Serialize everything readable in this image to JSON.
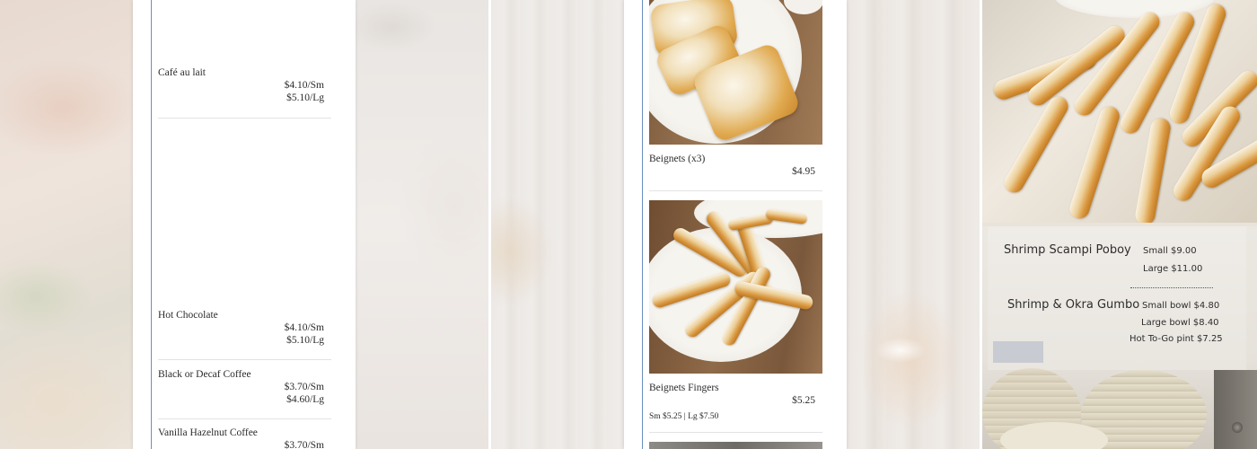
{
  "left_column": {
    "items": [
      {
        "name": "Café au lait",
        "prices": [
          "$4.10/Sm",
          "$5.10/Lg"
        ]
      },
      {
        "name": "Hot Chocolate",
        "prices": [
          "$4.10/Sm",
          "$5.10/Lg"
        ]
      },
      {
        "name": "Black or Decaf Coffee",
        "prices": [
          "$3.70/Sm",
          "$4.60/Lg"
        ]
      },
      {
        "name": "Vanilla Hazelnut Coffee",
        "prices": [
          "$3.70/Sm"
        ]
      }
    ]
  },
  "middle_column": {
    "items": [
      {
        "name": "Beignets (x3)",
        "price": "$4.95",
        "photo_icon": "beignets-photo"
      },
      {
        "name": "Beignets Fingers",
        "price": "$5.25",
        "note": "Sm $5.25 | Lg $7.50",
        "photo_icon": "beignet-fingers-photo"
      }
    ]
  },
  "sign": {
    "rows": [
      {
        "title": "Shrimp Scampi Poboy",
        "prices": [
          "Small $9.00",
          "Large $11.00"
        ]
      },
      {
        "title": "Shrimp & Okra Gumbo",
        "prices": [
          "Small bowl $4.80",
          "Large bowl $8.40",
          "Hot To-Go pint $7.25"
        ]
      }
    ]
  },
  "colors": {
    "card_rule": "#6a8fc0",
    "text": "#2b2b2b",
    "separator": "#e3e3e3"
  }
}
